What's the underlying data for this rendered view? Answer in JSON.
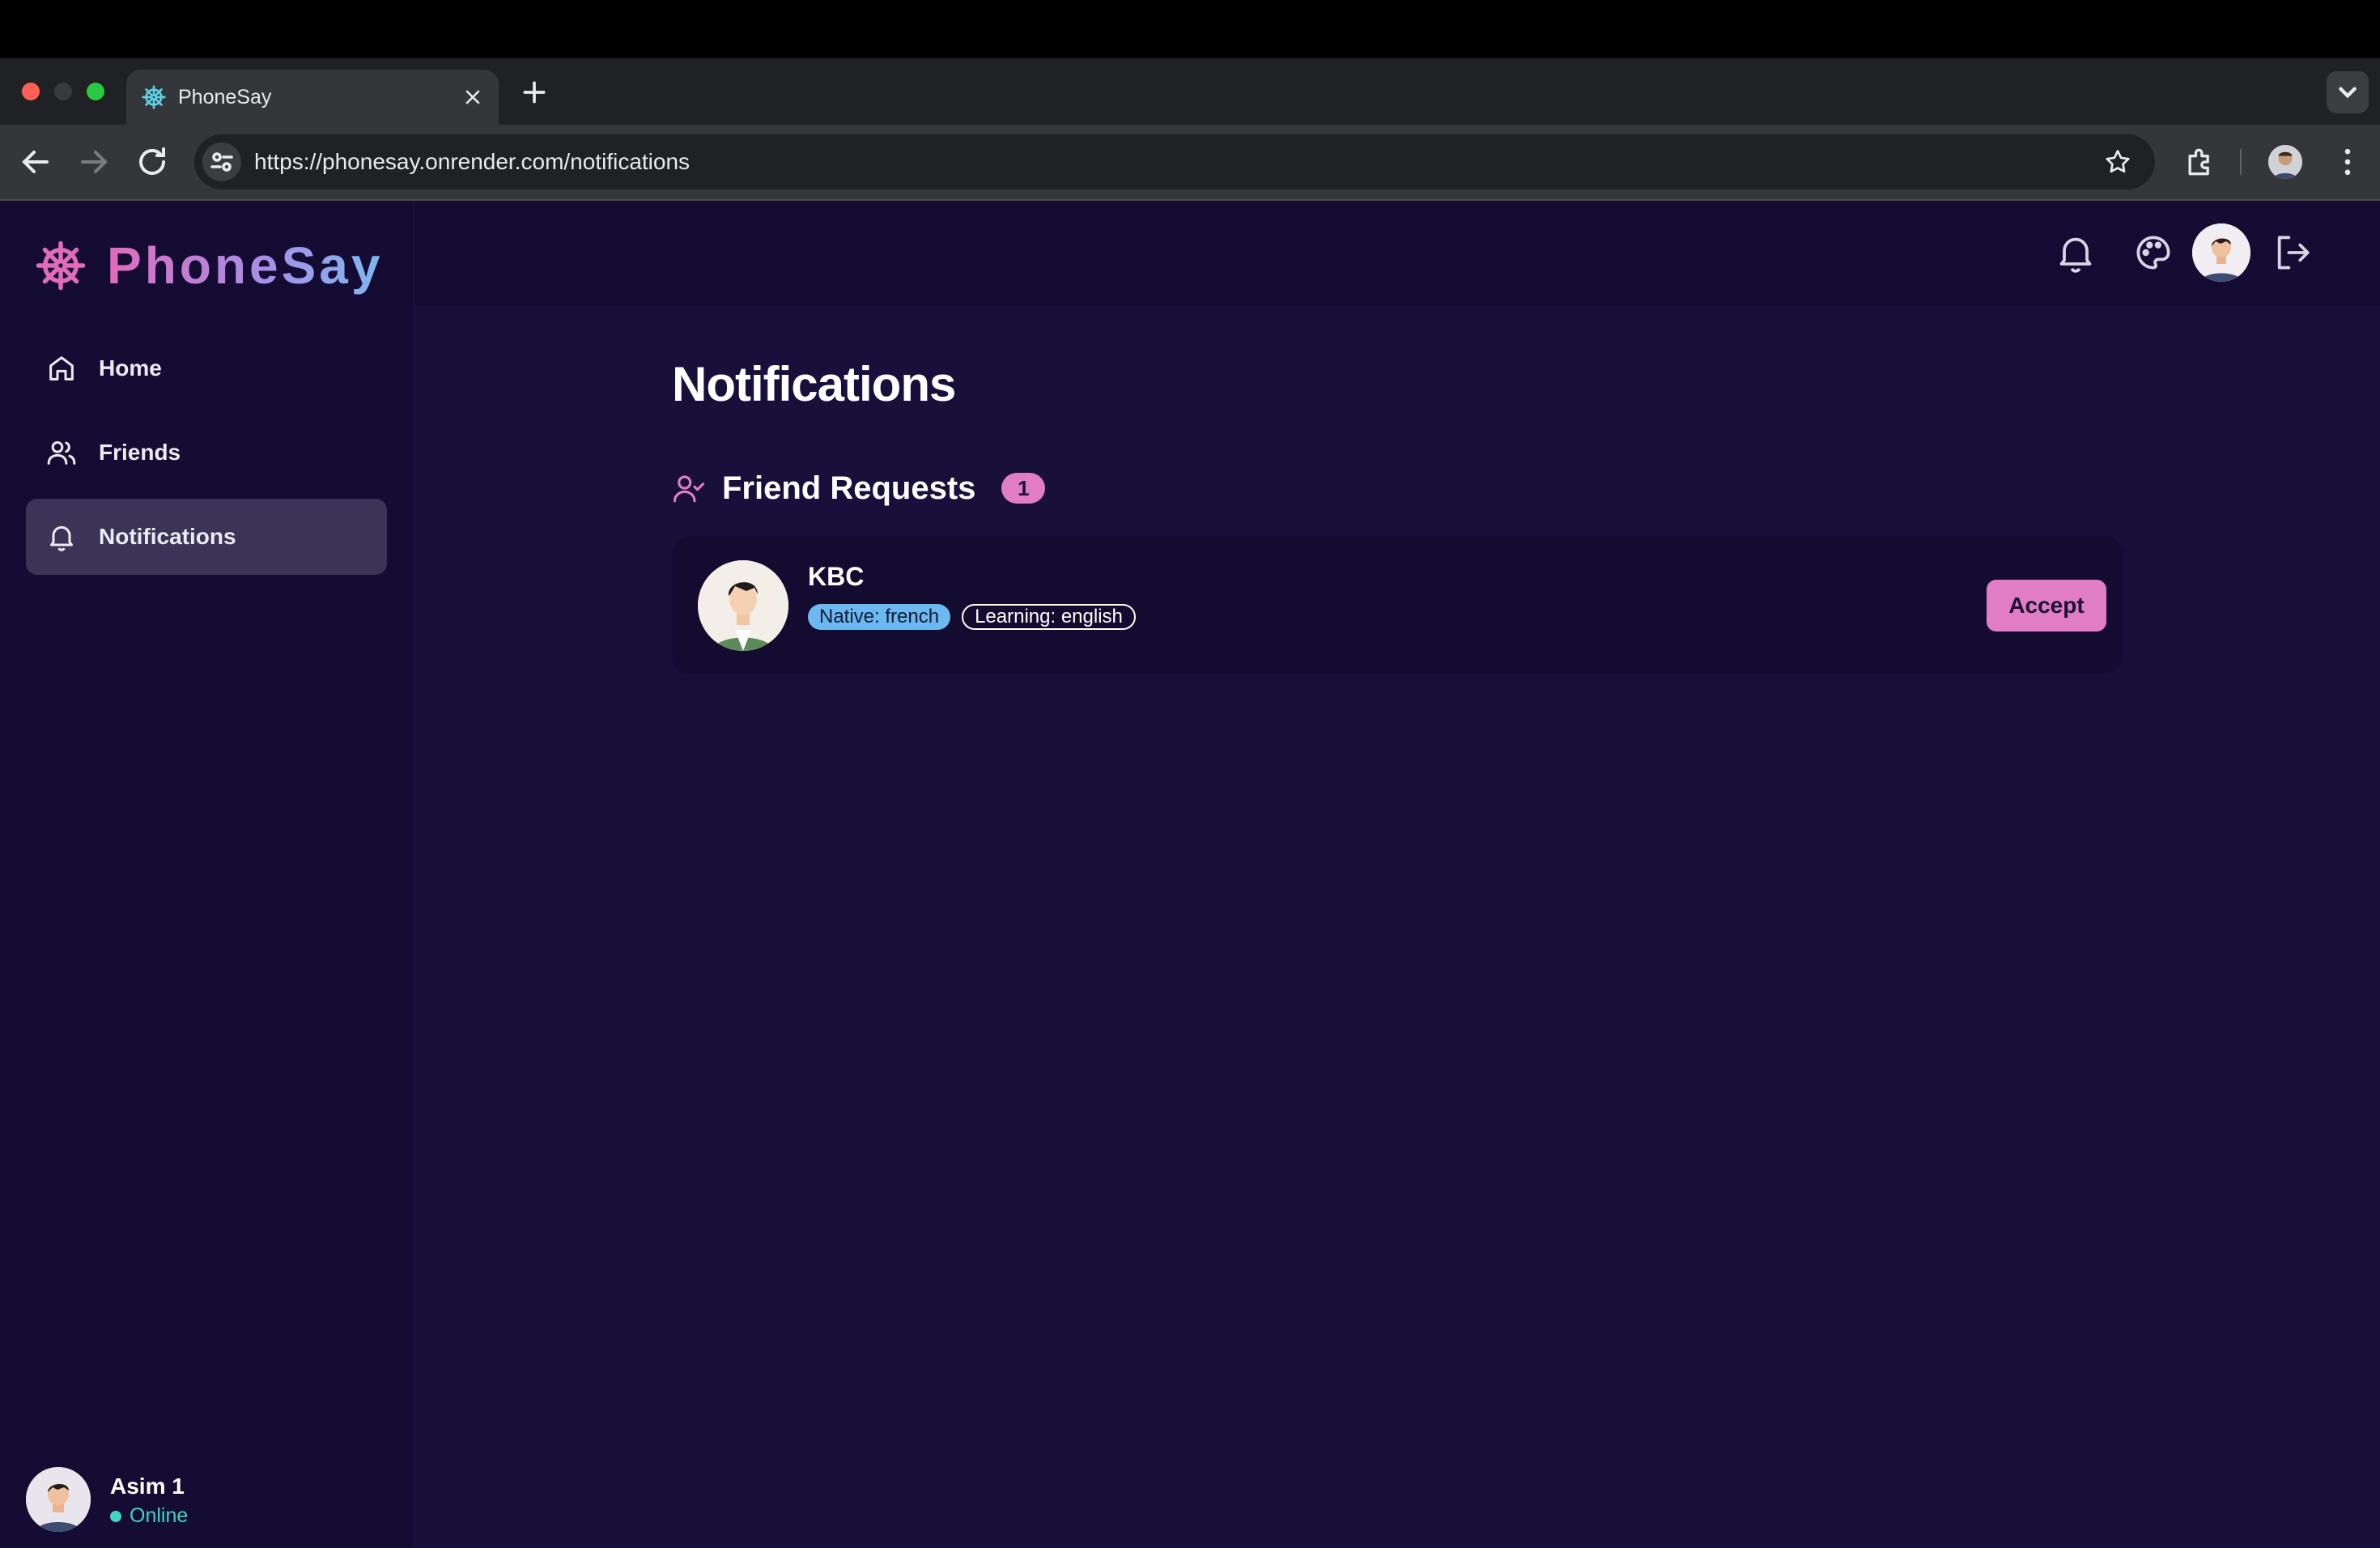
{
  "browser": {
    "tab_title": "PhoneSay",
    "url": "https://phonesay.onrender.com/notifications"
  },
  "app": {
    "logo_text": "PhoneSay",
    "colors": {
      "accent": "#e07dc6",
      "native_badge": "#6cb8f0",
      "online": "#3cd6c1",
      "background": "#180f3a"
    }
  },
  "sidebar": {
    "items": [
      {
        "label": "Home",
        "icon": "home-icon"
      },
      {
        "label": "Friends",
        "icon": "users-icon"
      },
      {
        "label": "Notifications",
        "icon": "bell-icon",
        "active": true
      }
    ],
    "user": {
      "name": "Asim 1",
      "status": "Online"
    }
  },
  "main": {
    "page_title": "Notifications",
    "section": {
      "title": "Friend Requests",
      "count": "1",
      "icon": "user-check-icon"
    },
    "requests": [
      {
        "name": "KBC",
        "native": "Native: french",
        "learning": "Learning: english",
        "action": "Accept"
      }
    ]
  }
}
